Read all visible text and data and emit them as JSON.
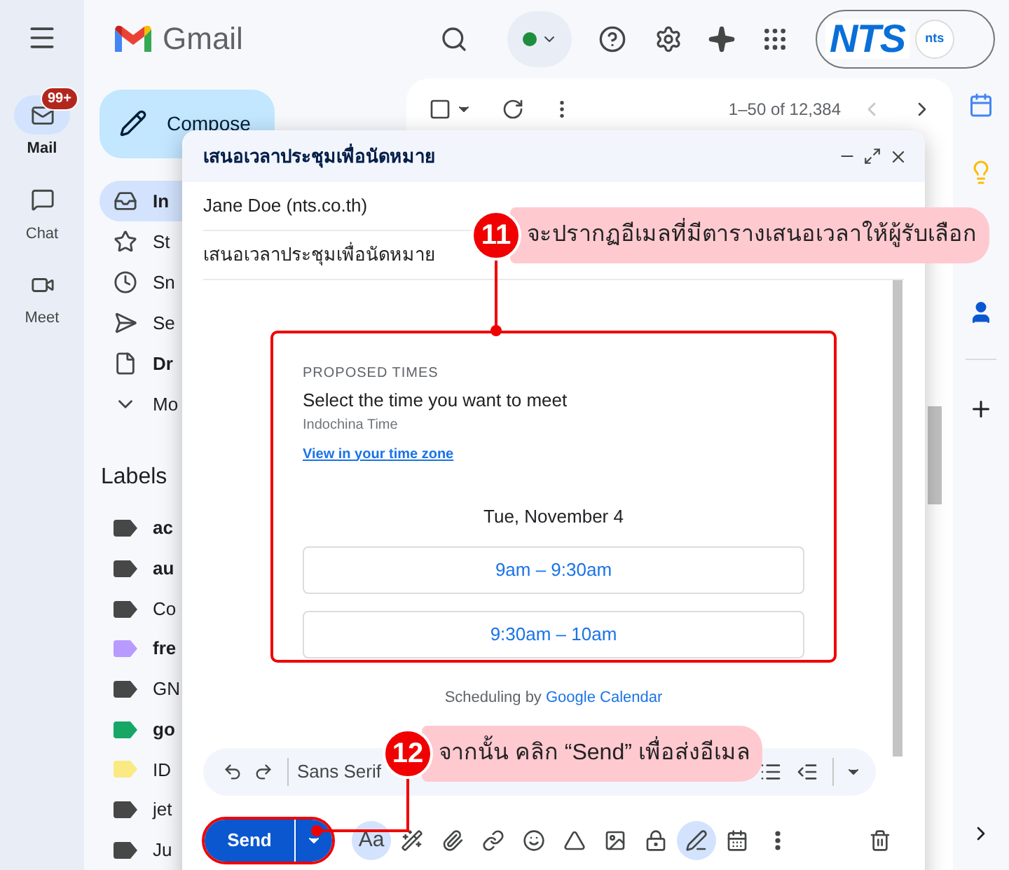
{
  "rail": [
    {
      "label": "Mail",
      "selected": true,
      "badge": "99+",
      "kind": "mail"
    },
    {
      "label": "Chat",
      "selected": false,
      "kind": "chat"
    },
    {
      "label": "Meet",
      "selected": false,
      "kind": "meet"
    }
  ],
  "header": {
    "app_name": "Gmail",
    "account_logo": "NTS",
    "account_avatar": "nts"
  },
  "compose_button": "Compose",
  "nav": [
    {
      "label": "In",
      "selected": true,
      "bold": true,
      "kind": "inbox"
    },
    {
      "label": "St",
      "selected": false,
      "bold": false,
      "kind": "star"
    },
    {
      "label": "Sn",
      "selected": false,
      "bold": false,
      "kind": "snooze"
    },
    {
      "label": "Se",
      "selected": false,
      "bold": false,
      "kind": "sent"
    },
    {
      "label": "Dr",
      "selected": false,
      "bold": true,
      "kind": "draft"
    },
    {
      "label": "Mo",
      "selected": false,
      "bold": false,
      "kind": "more"
    }
  ],
  "labels_heading": "Labels",
  "labels": [
    {
      "name": "ac",
      "bold": true,
      "color": "#474747"
    },
    {
      "name": "au",
      "bold": true,
      "color": "#474747"
    },
    {
      "name": "Co",
      "bold": false,
      "color": "#474747"
    },
    {
      "name": "fre",
      "bold": true,
      "color": "#b99aff"
    },
    {
      "name": "GN",
      "bold": false,
      "color": "#474747"
    },
    {
      "name": "go",
      "bold": true,
      "color": "#16a765"
    },
    {
      "name": "ID",
      "bold": false,
      "color": "#fbe983"
    },
    {
      "name": "jet",
      "bold": false,
      "color": "#474747"
    },
    {
      "name": "Ju",
      "bold": false,
      "color": "#474747"
    }
  ],
  "mail_list": {
    "range": "1–50 of 12,384"
  },
  "compose": {
    "title": "เสนอเวลาประชุมเพื่อนัดหมาย",
    "to": "Jane Doe (nts.co.th)",
    "subject": "เสนอเวลาประชุมเพื่อนัดหมาย",
    "card": {
      "eyebrow": "PROPOSED TIMES",
      "heading": "Select the time you want to meet",
      "timezone": "Indochina Time",
      "link": "View in your time zone",
      "date": "Tue, November 4",
      "slots": [
        {
          "label": "9am – 9:30am"
        },
        {
          "label": "9:30am – 10am"
        }
      ]
    },
    "footer_prefix": "Scheduling by",
    "footer_link": "Google Calendar",
    "font": "Sans Serif",
    "send": "Send",
    "tools": [
      {
        "kind": "aa",
        "label": "Aa",
        "selected": true
      },
      {
        "kind": "wand",
        "selected": false
      },
      {
        "kind": "attach",
        "selected": false
      },
      {
        "kind": "link",
        "selected": false
      },
      {
        "kind": "emoji",
        "selected": false
      },
      {
        "kind": "drive",
        "selected": false
      },
      {
        "kind": "image",
        "selected": false
      },
      {
        "kind": "lock",
        "selected": false
      },
      {
        "kind": "pen",
        "selected": true
      },
      {
        "kind": "calendar",
        "selected": false
      },
      {
        "kind": "more",
        "selected": false
      }
    ]
  },
  "callouts": [
    {
      "number": "11",
      "text": "จะปรากฏอีเมลที่มีตารางเสนอเวลาให้ผู้รับเลือก"
    },
    {
      "number": "12",
      "text": "จากนั้น คลิก “Send” เพื่อส่งอีเมล"
    }
  ]
}
